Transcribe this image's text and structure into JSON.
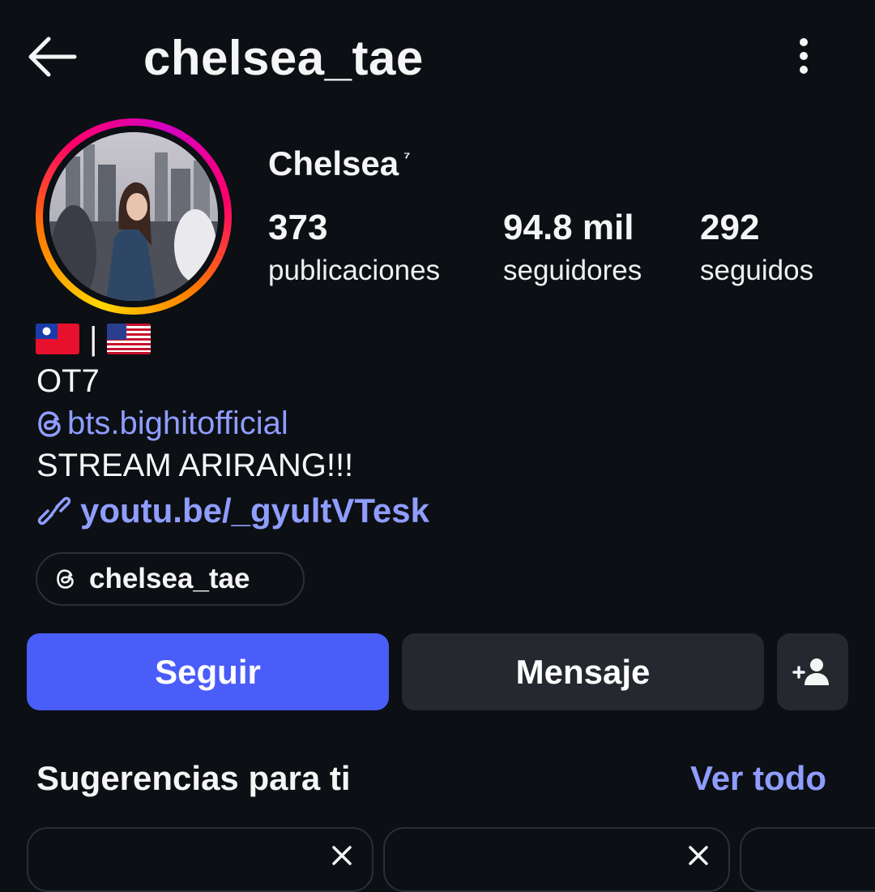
{
  "header": {
    "username": "chelsea_tae",
    "back_icon": "arrow-left-icon",
    "more_icon": "more-vertical-icon"
  },
  "profile": {
    "display_name": "Chelsea",
    "display_name_suffix": "⁷",
    "stats": {
      "posts": {
        "value": "373",
        "label": "publicaciones"
      },
      "followers": {
        "value": "94.8 mil",
        "label": "seguidores"
      },
      "following": {
        "value": "292",
        "label": "seguidos"
      }
    },
    "bio": {
      "line1_separator": "|",
      "line1_flags": [
        "flag-taiwan",
        "flag-usa"
      ],
      "line2": "OT7",
      "mention": "bts.bighitofficial",
      "line4": "STREAM ARIRANG!!!",
      "link": "youtu.be/_gyultVTesk"
    },
    "threads_chip": {
      "label": "chelsea_tae",
      "icon": "threads-icon"
    }
  },
  "actions": {
    "follow": "Seguir",
    "message": "Mensaje",
    "suggest_icon": "add-person-icon"
  },
  "suggestions": {
    "title": "Sugerencias para ti",
    "see_all": "Ver todo"
  },
  "colors": {
    "background": "#0c0f14",
    "accent": "#4a5df9",
    "link": "#8f9dff",
    "secondary_button": "#25282e"
  }
}
